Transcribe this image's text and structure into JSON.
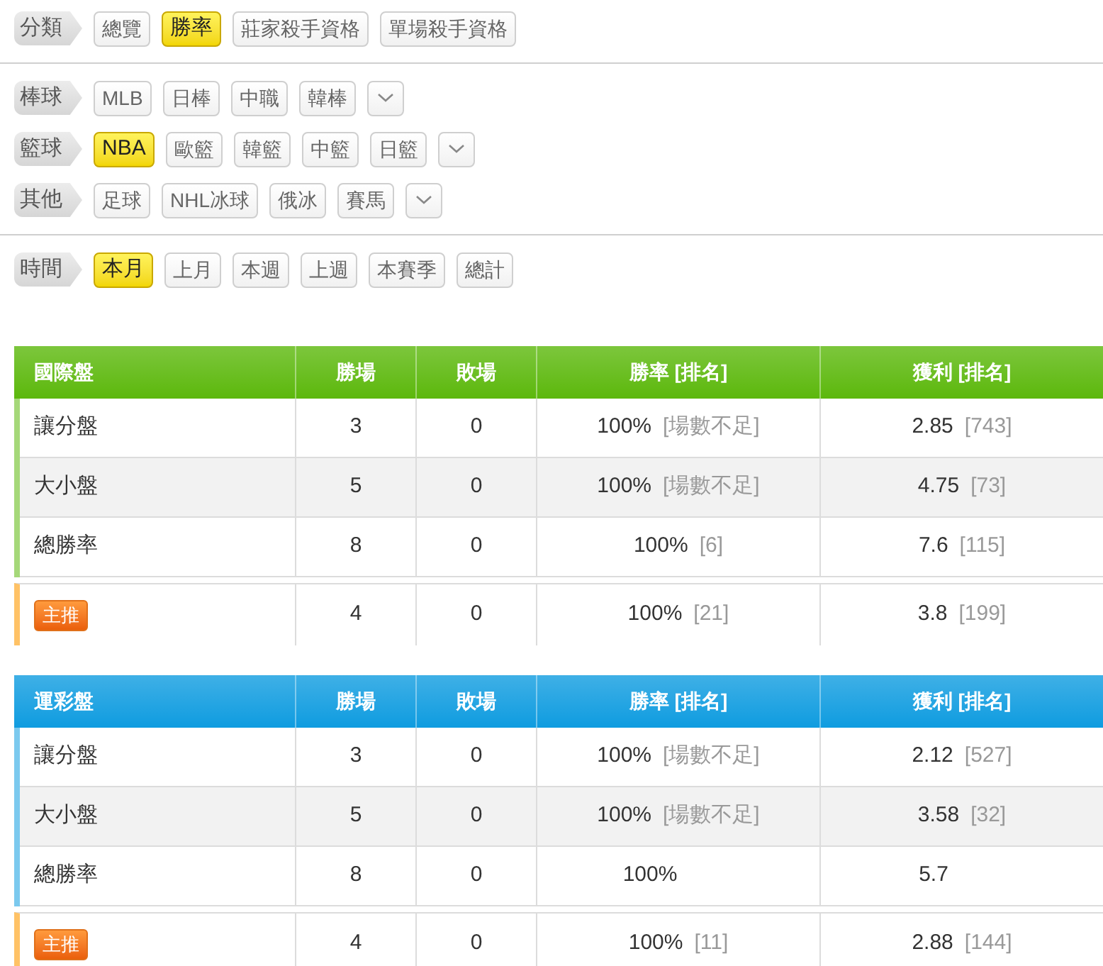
{
  "filter_groups": [
    [
      {
        "label": "分類",
        "options": [
          {
            "label": "總覽",
            "selected": false
          },
          {
            "label": "勝率",
            "selected": true
          },
          {
            "label": "莊家殺手資格",
            "selected": false
          },
          {
            "label": "單場殺手資格",
            "selected": false
          }
        ],
        "dropdown": false
      }
    ],
    [
      {
        "label": "棒球",
        "options": [
          {
            "label": "MLB",
            "selected": false
          },
          {
            "label": "日棒",
            "selected": false
          },
          {
            "label": "中職",
            "selected": false
          },
          {
            "label": "韓棒",
            "selected": false
          }
        ],
        "dropdown": true
      },
      {
        "label": "籃球",
        "options": [
          {
            "label": "NBA",
            "selected": true
          },
          {
            "label": "歐籃",
            "selected": false
          },
          {
            "label": "韓籃",
            "selected": false
          },
          {
            "label": "中籃",
            "selected": false
          },
          {
            "label": "日籃",
            "selected": false
          }
        ],
        "dropdown": true
      },
      {
        "label": "其他",
        "options": [
          {
            "label": "足球",
            "selected": false
          },
          {
            "label": "NHL冰球",
            "selected": false
          },
          {
            "label": "俄冰",
            "selected": false
          },
          {
            "label": "賽馬",
            "selected": false
          }
        ],
        "dropdown": true
      }
    ],
    [
      {
        "label": "時間",
        "options": [
          {
            "label": "本月",
            "selected": true
          },
          {
            "label": "上月",
            "selected": false
          },
          {
            "label": "本週",
            "selected": false
          },
          {
            "label": "上週",
            "selected": false
          },
          {
            "label": "本賽季",
            "selected": false
          },
          {
            "label": "總計",
            "selected": false
          }
        ],
        "dropdown": false
      }
    ]
  ],
  "tables": [
    {
      "title": "國際盤",
      "color": "#5cb80c",
      "columns": [
        "勝場",
        "敗場",
        "勝率 [排名]",
        "獲利 [排名]"
      ],
      "rows": [
        {
          "label": "讓分盤",
          "wins": "3",
          "losses": "0",
          "rate": "100%",
          "rate_rank": "[場數不足]",
          "profit": "2.85",
          "profit_rank": "[743]"
        },
        {
          "label": "大小盤",
          "wins": "5",
          "losses": "0",
          "rate": "100%",
          "rate_rank": "[場數不足]",
          "profit": "4.75",
          "profit_rank": "[73]"
        },
        {
          "label": "總勝率",
          "wins": "8",
          "losses": "0",
          "rate": "100%",
          "rate_rank": "[6]",
          "profit": "7.6",
          "profit_rank": "[115]"
        }
      ],
      "featured": {
        "badge": "主推",
        "wins": "4",
        "losses": "0",
        "rate": "100%",
        "rate_rank": "[21]",
        "profit": "3.8",
        "profit_rank": "[199]"
      }
    },
    {
      "title": "運彩盤",
      "color": "#0f9ce0",
      "columns": [
        "勝場",
        "敗場",
        "勝率 [排名]",
        "獲利 [排名]"
      ],
      "rows": [
        {
          "label": "讓分盤",
          "wins": "3",
          "losses": "0",
          "rate": "100%",
          "rate_rank": "[場數不足]",
          "profit": "2.12",
          "profit_rank": "[527]"
        },
        {
          "label": "大小盤",
          "wins": "5",
          "losses": "0",
          "rate": "100%",
          "rate_rank": "[場數不足]",
          "profit": "3.58",
          "profit_rank": "[32]"
        },
        {
          "label": "總勝率",
          "wins": "8",
          "losses": "0",
          "rate": "100%",
          "profit": "5.7"
        }
      ],
      "featured": {
        "badge": "主推",
        "wins": "4",
        "losses": "0",
        "rate": "100%",
        "rate_rank": "[11]",
        "profit": "2.88",
        "profit_rank": "[144]"
      }
    }
  ]
}
